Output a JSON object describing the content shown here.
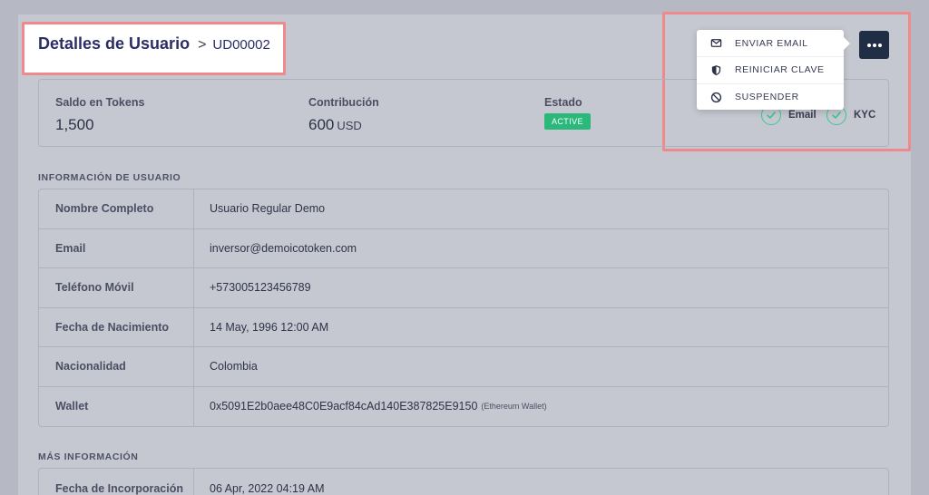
{
  "header": {
    "title": "Detalles de Usuario",
    "separator": ">",
    "user_id": "UD00002"
  },
  "summary": {
    "tokens": {
      "label": "Saldo en Tokens",
      "value": "1,500"
    },
    "contribution": {
      "label": "Contribución",
      "value": "600",
      "unit": "USD"
    },
    "status": {
      "label": "Estado",
      "badge": "ACTIVE"
    },
    "verifications": [
      {
        "label": "Email",
        "icon": "check-circle-icon"
      },
      {
        "label": "KYC",
        "icon": "check-circle-icon"
      }
    ]
  },
  "actions_menu": {
    "button_icon": "more-dots-icon",
    "items": [
      {
        "label": "ENVIAR EMAIL",
        "icon": "envelope-icon"
      },
      {
        "label": "REINICIAR CLAVE",
        "icon": "shield-icon"
      },
      {
        "label": "SUSPENDER",
        "icon": "ban-icon"
      }
    ]
  },
  "user_info": {
    "title": "INFORMACIÓN DE USUARIO",
    "rows": [
      {
        "key": "Nombre Completo",
        "value": "Usuario Regular Demo"
      },
      {
        "key": "Email",
        "value": "inversor@demoicotoken.com"
      },
      {
        "key": "Teléfono Móvil",
        "value": "+573005123456789"
      },
      {
        "key": "Fecha de Nacimiento",
        "value": "14 May, 1996 12:00 AM"
      },
      {
        "key": "Nacionalidad",
        "value": "Colombia"
      },
      {
        "key": "Wallet",
        "value": "0x5091E2b0aee48C0E9acf84cAd140E387825E9150",
        "note": "(Ethereum Wallet)"
      }
    ]
  },
  "more_info": {
    "title": "MÁS INFORMACIÓN",
    "rows": [
      {
        "key": "Fecha de Incorporación",
        "value": "06 Apr, 2022 04:19 AM"
      }
    ]
  },
  "colors": {
    "backdrop": "#b6b8c3",
    "highlight": "#ef8a8c",
    "accent_dark": "#1f2e44",
    "title_navy": "#2b2e66",
    "success": "#2ab97a"
  }
}
